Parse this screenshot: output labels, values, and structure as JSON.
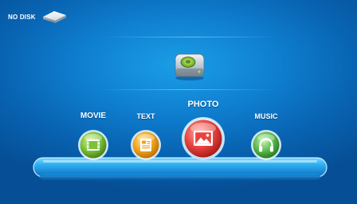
{
  "status": {
    "disk_text": "NO DISK",
    "disk_icon": "usb-drive-icon"
  },
  "device": {
    "icon": "hard-drive-icon"
  },
  "menu": {
    "items": [
      {
        "label": "MOVIE",
        "icon": "film-strip-icon",
        "color": "#7cc13a",
        "selected": false
      },
      {
        "label": "TEXT",
        "icon": "document-icon",
        "color": "#f0a21c",
        "selected": false
      },
      {
        "label": "PHOTO",
        "icon": "picture-icon",
        "color": "#e9433f",
        "selected": true
      },
      {
        "label": "MUSIC",
        "icon": "headphones-icon",
        "color": "#58b84b",
        "selected": false
      }
    ]
  },
  "colors": {
    "background": "#0f7fd0",
    "shelf": "#2aa9f0",
    "label": "#ffffff"
  }
}
